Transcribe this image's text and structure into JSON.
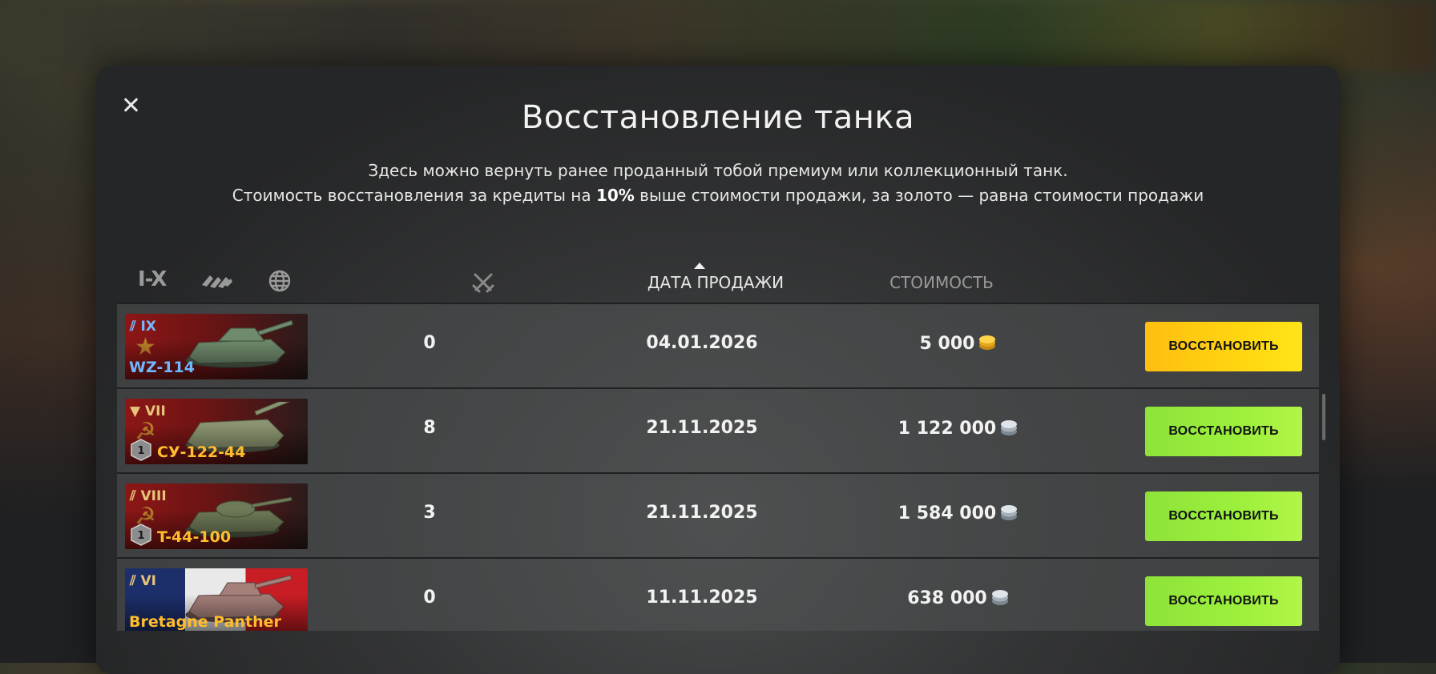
{
  "dialog": {
    "title": "Восстановление танка",
    "subtitle_line1": "Здесь можно вернуть ранее проданный тобой премиум или коллекционный танк.",
    "subtitle_line2_pre": "Стоимость восстановления за кредиты на ",
    "subtitle_line2_bold": "10%",
    "subtitle_line2_post": " выше стоимости продажи, за золото — равна стоимости продажи"
  },
  "filters": {
    "tier_label": "I-X",
    "type_icon": "vehicle-type-icon",
    "nation_icon": "globe-icon",
    "battles_icon": "crossed-swords-icon"
  },
  "columns": {
    "date": "ДАТА ПРОДАЖИ",
    "cost": "СТОИМОСТЬ",
    "sort": "ascending-arrow"
  },
  "rows": [
    {
      "tier": "IX",
      "name": "WZ-114",
      "nation": "china",
      "battles": "0",
      "date": "04.01.2026",
      "cost": "5 000",
      "currency": "gold",
      "button": "ВОССТАНОВИТЬ"
    },
    {
      "tier": "VII",
      "name": "СУ-122-44",
      "nation": "ussr",
      "mastery": "1",
      "battles": "8",
      "date": "21.11.2025",
      "cost": "1 122 000",
      "currency": "credits",
      "button": "ВОССТАНОВИТЬ"
    },
    {
      "tier": "VIII",
      "name": "T-44-100",
      "nation": "ussr",
      "mastery": "1",
      "battles": "3",
      "date": "21.11.2025",
      "cost": "1 584 000",
      "currency": "credits",
      "button": "ВОССТАНОВИТЬ"
    },
    {
      "tier": "VI",
      "name": "Bretagne Panther",
      "nation": "france",
      "battles": "0",
      "date": "11.11.2025",
      "cost": "638 000",
      "currency": "credits",
      "button": "ВОССТАНОВИТЬ"
    }
  ],
  "colors": {
    "gold_button": "#ffd510",
    "credit_button": "#9cf03c"
  }
}
